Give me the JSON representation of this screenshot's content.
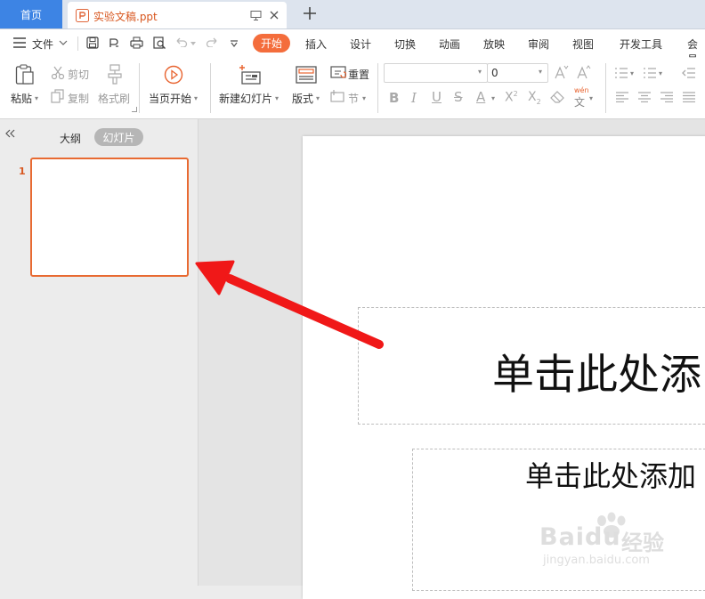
{
  "tabs": {
    "home_label": "首页",
    "doc_title": "实验文稿.ppt",
    "new_tab_icon": "plus-icon"
  },
  "menu": {
    "file_label": "文件",
    "items": [
      "开始",
      "插入",
      "设计",
      "切换",
      "动画",
      "放映",
      "审阅",
      "视图",
      "开发工具",
      "会员"
    ],
    "active": "开始",
    "accent_color": "#f46d3c"
  },
  "ribbon": {
    "paste": "粘贴",
    "cut": "剪切",
    "copy": "复制",
    "format_painter": "格式刷",
    "from_current": "当页开始",
    "new_slide": "新建幻灯片",
    "layout": "版式",
    "reset": "重置",
    "section": "节",
    "font_name": "",
    "font_size": "0",
    "phonetic_top": "wén",
    "phonetic_bottom": "文"
  },
  "left_panel": {
    "view_outline": "大纲",
    "view_slides": "幻灯片",
    "slide_number": "1"
  },
  "slide": {
    "title_placeholder": "单击此处添",
    "subtitle_placeholder": "单击此处添加"
  },
  "watermark": {
    "brand": "Baidu",
    "suffix": "经验",
    "url": "jingyan.baidu.com"
  },
  "annotation": {
    "arrow_color": "#f01818"
  }
}
